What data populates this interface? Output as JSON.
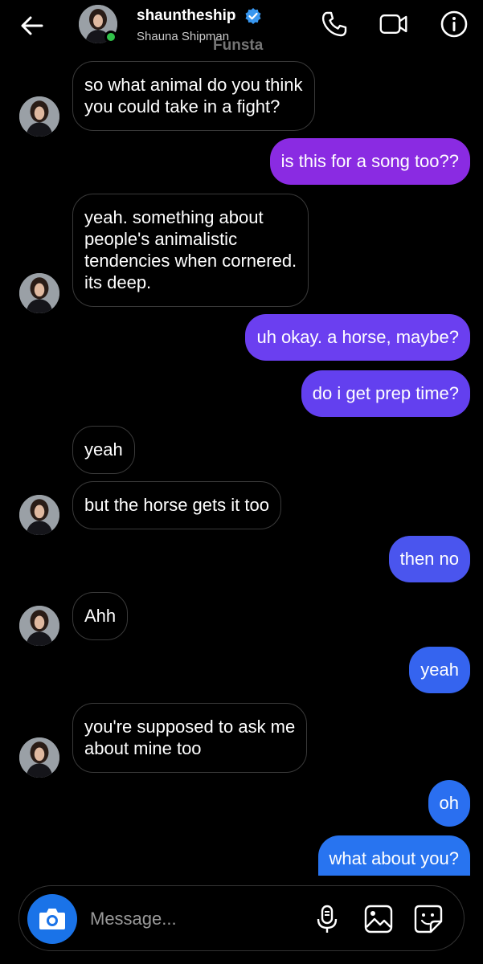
{
  "header": {
    "username": "shauntheship",
    "full_name": "Shauna Shipman",
    "watermark": "Funsta",
    "icons": [
      "back-arrow-icon",
      "verified-badge-icon",
      "phone-icon",
      "video-camera-icon",
      "info-icon"
    ]
  },
  "colors": {
    "background": "#000000",
    "incoming_border": "#3a3a3a",
    "outgoing_top": "#8a2be2",
    "outgoing_bottom": "#2874f0",
    "online": "#31c24a",
    "camera_button": "#1a73e8",
    "verified": "#3897f0"
  },
  "messages": [
    {
      "dir": "in",
      "lines": [
        "so what animal do you think",
        "you could take in a fight?"
      ],
      "avatar": true
    },
    {
      "dir": "out",
      "lines": [
        "is this for a song too??"
      ]
    },
    {
      "dir": "in",
      "lines": [
        "yeah. something about",
        "people's animalistic",
        "tendencies when cornered.",
        "its deep."
      ],
      "avatar": true
    },
    {
      "dir": "out",
      "lines": [
        "uh okay. a horse, maybe?"
      ]
    },
    {
      "dir": "out",
      "lines": [
        "do i get prep time?"
      ]
    },
    {
      "dir": "in",
      "lines": [
        "yeah"
      ],
      "avatar": false
    },
    {
      "dir": "in",
      "lines": [
        "but the horse gets it too"
      ],
      "avatar": true
    },
    {
      "dir": "out",
      "lines": [
        "then no"
      ]
    },
    {
      "dir": "in",
      "lines": [
        "Ahh"
      ],
      "avatar": true
    },
    {
      "dir": "out",
      "lines": [
        "yeah"
      ]
    },
    {
      "dir": "in",
      "lines": [
        "you're supposed to ask me",
        "about mine too"
      ],
      "avatar": true
    },
    {
      "dir": "out",
      "lines": [
        "oh"
      ]
    },
    {
      "dir": "out",
      "lines": [
        "what about you?"
      ]
    }
  ],
  "composer": {
    "placeholder": "Message...",
    "icons": [
      "camera-icon",
      "microphone-icon",
      "gallery-icon",
      "sticker-icon"
    ]
  }
}
